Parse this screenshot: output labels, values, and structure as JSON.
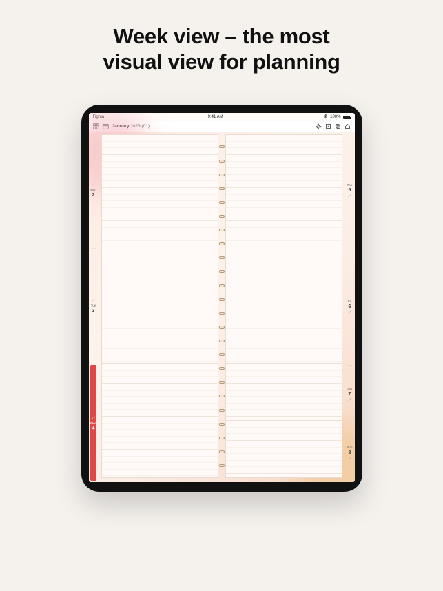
{
  "headline": {
    "line1": "Week view – the most",
    "line2": "visual view for planning"
  },
  "status_bar": {
    "app_name": "Figma",
    "time": "9:41 AM",
    "battery_pct": "100%"
  },
  "app_bar": {
    "title_strong": "January",
    "title_rest": " 2023 (01)"
  },
  "days": {
    "left": [
      {
        "dow": "Mon",
        "num": "2",
        "active": false
      },
      {
        "dow": "Tue",
        "num": "3",
        "active": false
      },
      {
        "dow": "Wed",
        "num": "4",
        "active": true
      }
    ],
    "right": [
      {
        "dow": "Thu",
        "num": "5",
        "active": false
      },
      {
        "dow": "Fri",
        "num": "6",
        "active": false
      },
      {
        "dow": "Sat",
        "num": "7",
        "active": false
      },
      {
        "dow": "Sun",
        "num": "8",
        "active": false
      }
    ]
  }
}
